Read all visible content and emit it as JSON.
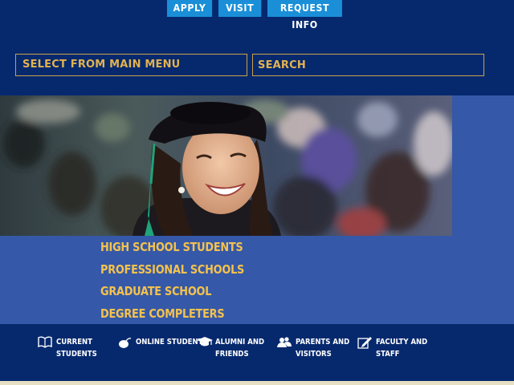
{
  "header": {
    "actions": [
      {
        "label": "APPLY"
      },
      {
        "label": "VISIT"
      },
      {
        "label": "REQUEST INFO"
      }
    ]
  },
  "main_menu": {
    "label": "SELECT FROM MAIN MENU"
  },
  "search": {
    "placeholder": "SEARCH"
  },
  "hero": {
    "image": "graduate-photo"
  },
  "audience_links": [
    {
      "label": "HIGH SCHOOL STUDENTS"
    },
    {
      "label": "PROFESSIONAL SCHOOLS"
    },
    {
      "label": "GRADUATE SCHOOL"
    },
    {
      "label": "DEGREE COMPLETERS"
    }
  ],
  "bottom_nav": [
    {
      "label": "CURRENT\nSTUDENTS",
      "icon": "book-icon"
    },
    {
      "label": "ONLINE STUDENTS",
      "icon": "mouse-icon"
    },
    {
      "label": "ALUMNI AND\nFRIENDS",
      "icon": "graduation-cap-icon"
    },
    {
      "label": "PARENTS AND\nVISITORS",
      "icon": "people-icon"
    },
    {
      "label": "FACULTY AND\nSTAFF",
      "icon": "pencil-icon"
    }
  ],
  "colors": {
    "background": "#06296e",
    "band": "#3558a8",
    "accent_gold": "#f3c24e",
    "button_blue": "#1a8fd8"
  }
}
